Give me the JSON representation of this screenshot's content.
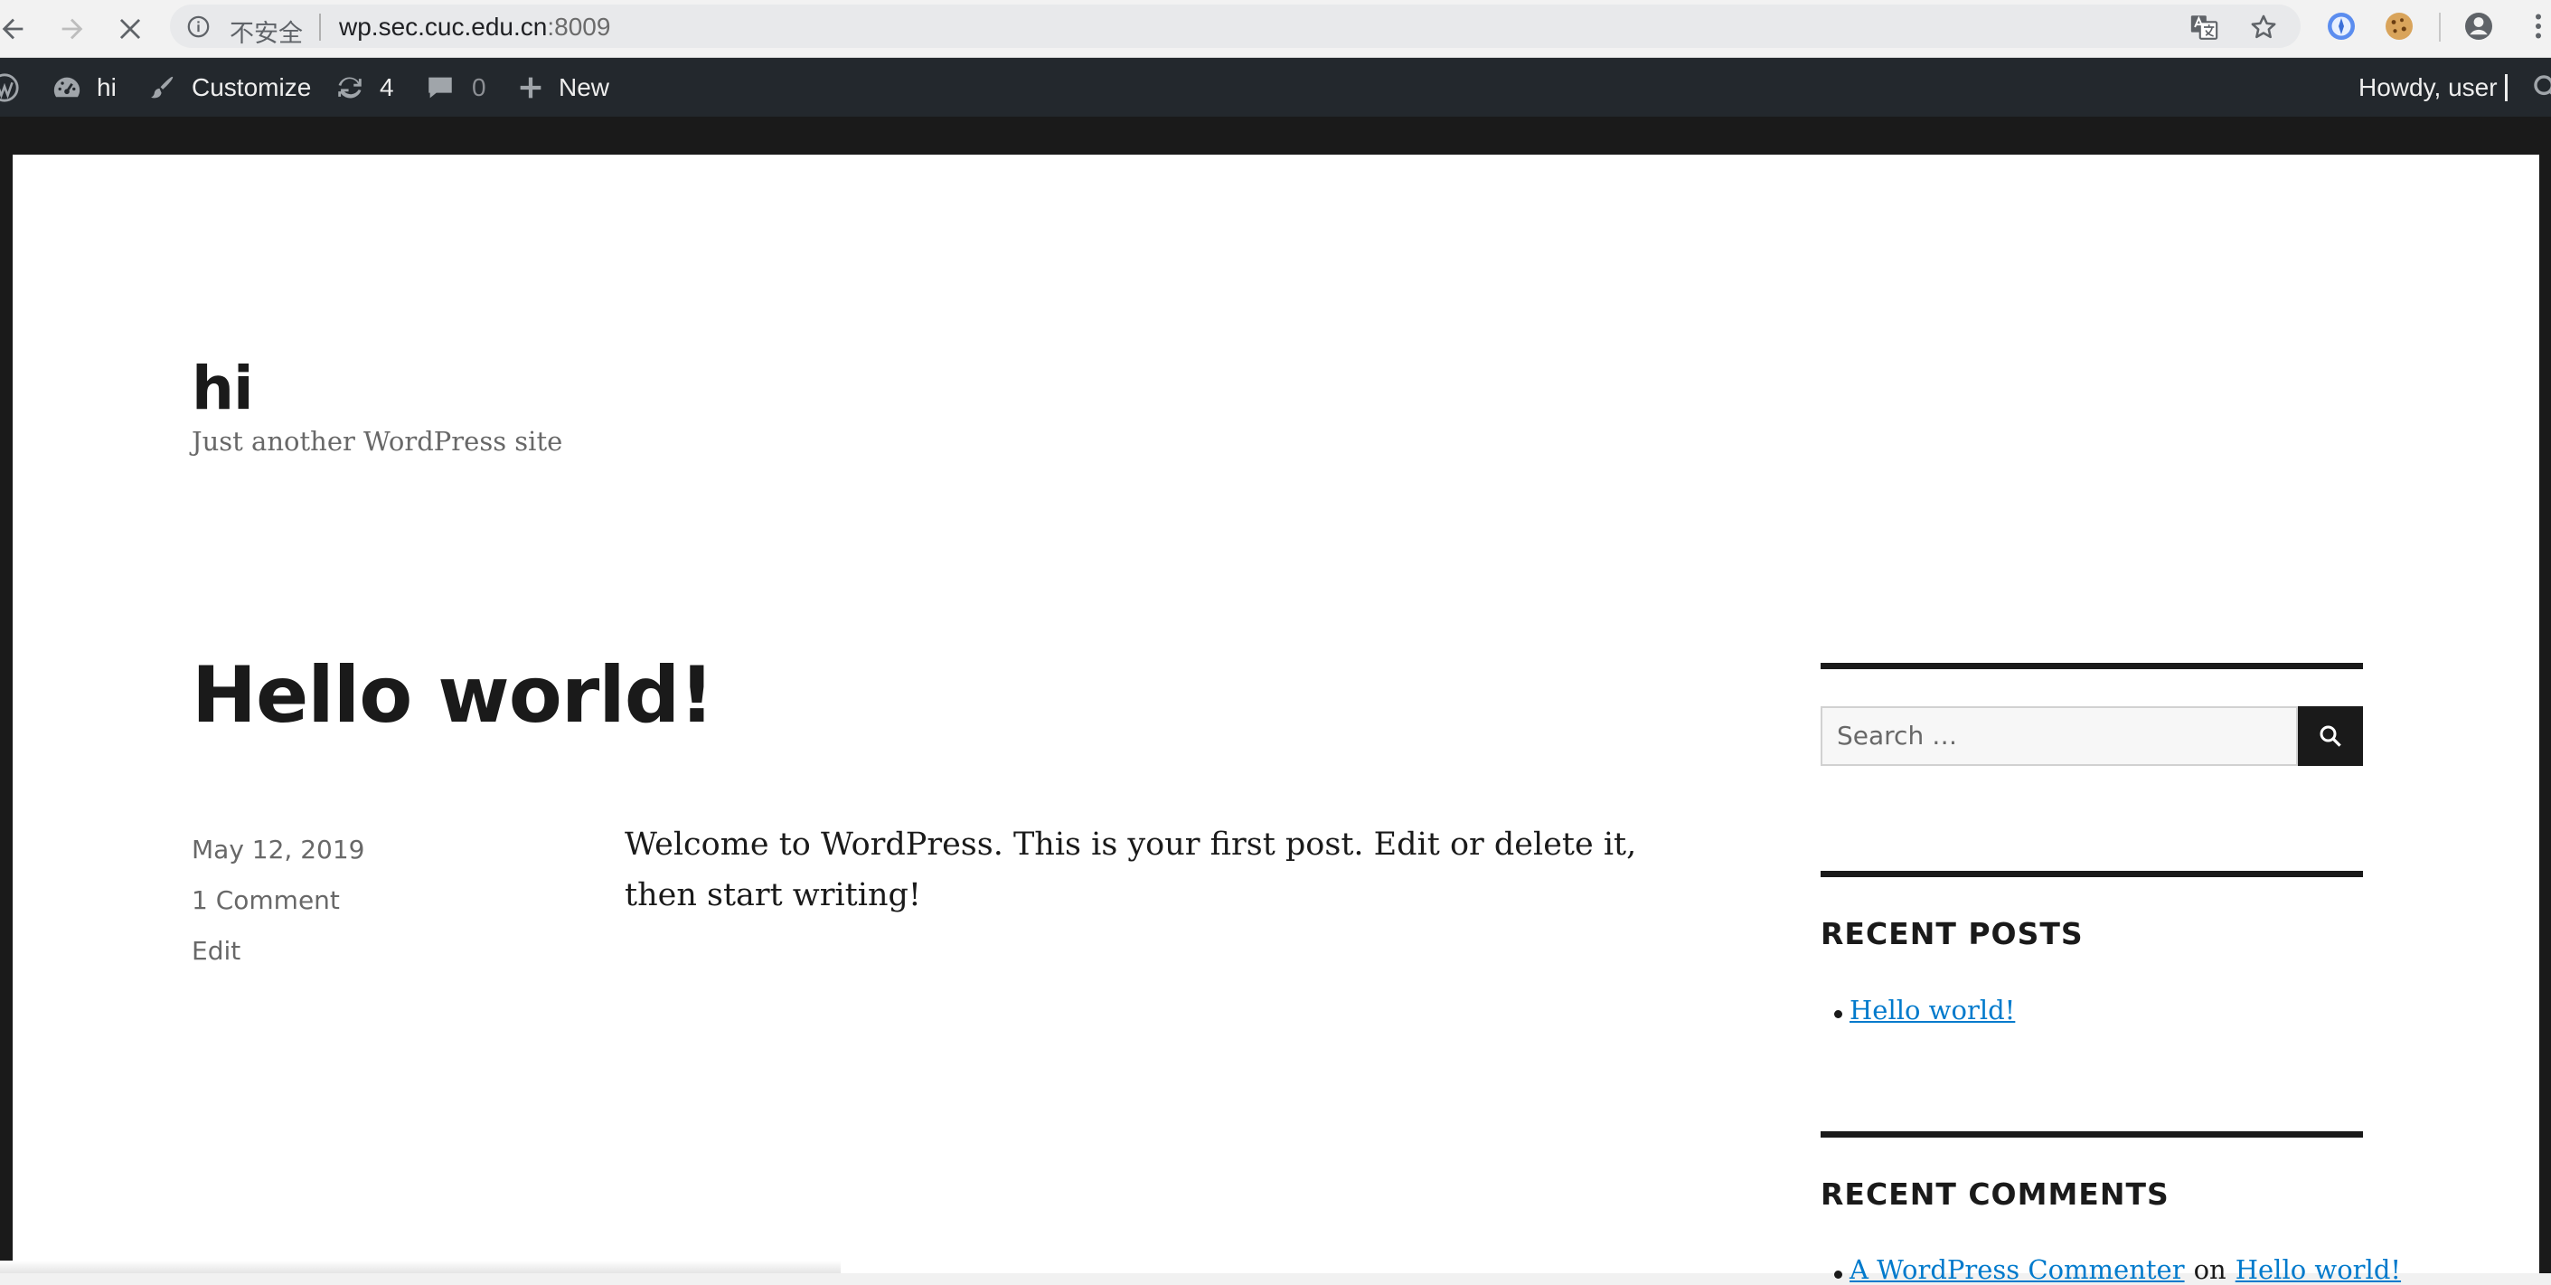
{
  "browser": {
    "insecure_label": "不安全",
    "url_host": "wp.sec.cuc.edu.cn",
    "url_port": ":8009"
  },
  "admin_bar": {
    "site_name": "hi",
    "customize": "Customize",
    "updates_count": "4",
    "comments_count": "0",
    "new_label": "New",
    "greeting": "Howdy, user"
  },
  "site": {
    "title": "hi",
    "description": "Just another WordPress site"
  },
  "post": {
    "title": "Hello world!",
    "date": "May 12, 2019",
    "comments_link": "1 Comment",
    "edit_link": "Edit",
    "content": "Welcome to WordPress. This is your first post. Edit or delete it, then start writing!"
  },
  "sidebar": {
    "search_placeholder": "Search …",
    "recent_posts_title": "RECENT POSTS",
    "recent_posts": [
      "Hello world!"
    ],
    "recent_comments_title": "RECENT COMMENTS",
    "recent_comment": {
      "author": "A WordPress Commenter",
      "connector": "on",
      "post": "Hello world!"
    }
  },
  "colors": {
    "admin_bar_bg": "#23282d",
    "link": "#007acc",
    "text": "#1a1a1a"
  }
}
